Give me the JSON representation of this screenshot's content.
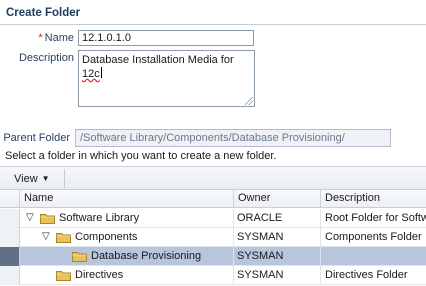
{
  "dialog": {
    "title": "Create Folder"
  },
  "form": {
    "required_marker": "*",
    "name_label": "Name",
    "name_value": "12.1.0.1.0",
    "description_label": "Description",
    "description_line1": "Database Installation Media for",
    "description_line2": "12c",
    "parent_label": "Parent Folder",
    "parent_value": "/Software Library/Components/Database Provisioning/",
    "instruction": "Select a folder in which you want to create a new folder."
  },
  "toolbar": {
    "view_label": "View"
  },
  "table": {
    "headers": {
      "name": "Name",
      "owner": "Owner",
      "description": "Description"
    },
    "rows": [
      {
        "name": "Software Library",
        "owner": "ORACLE",
        "description": "Root Folder for Software Library",
        "level": 0,
        "expanded": true,
        "selected": false
      },
      {
        "name": "Components",
        "owner": "SYSMAN",
        "description": "Components Folder",
        "level": 1,
        "expanded": true,
        "selected": false
      },
      {
        "name": "Database Provisioning",
        "owner": "SYSMAN",
        "description": "",
        "level": 2,
        "expanded": false,
        "selected": true
      },
      {
        "name": "Directives",
        "owner": "SYSMAN",
        "description": "Directives Folder",
        "level": 1,
        "expanded": false,
        "selected": false
      }
    ]
  },
  "colors": {
    "title": "#1f3d63",
    "label": "#2a3f66",
    "selection": "#b7c6dc",
    "folder": "#e8c25a"
  }
}
